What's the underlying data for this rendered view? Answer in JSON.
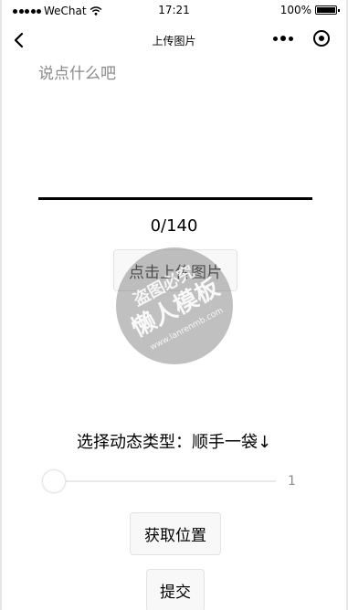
{
  "status_bar": {
    "carrier": "WeChat",
    "time": "17:21",
    "battery": "100%",
    "signal_icon": "signal-dots-icon",
    "wifi_icon": "wifi-icon",
    "battery_icon": "battery-icon"
  },
  "nav": {
    "title": "上传图片",
    "back_icon": "chevron-left-icon",
    "more_icon": "more-dots-icon",
    "close_icon": "target-circle-icon"
  },
  "post": {
    "placeholder": "说点什么吧",
    "counter": "0/140",
    "upload_label": "点击上传图片"
  },
  "watermark": {
    "line1": "盗图必究",
    "line2": "懒人模板",
    "line3": "www.lanrenmb.com"
  },
  "category": {
    "label": "选择动态类型：顺手一袋↓"
  },
  "slider": {
    "value": "1",
    "level": 0
  },
  "actions": {
    "location_label": "获取位置",
    "submit_label": "提交"
  }
}
